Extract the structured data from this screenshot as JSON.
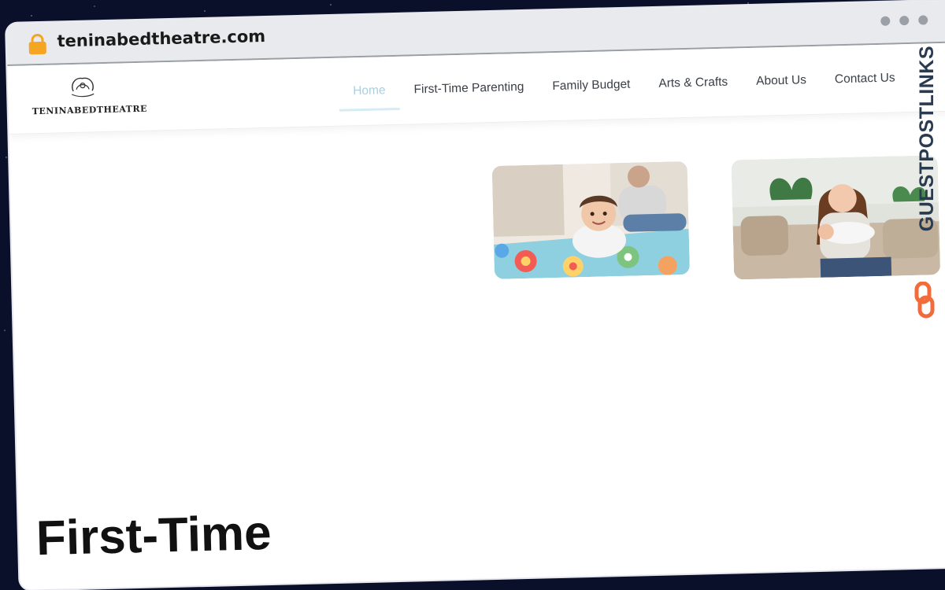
{
  "browser": {
    "url": "teninabedtheatre.com"
  },
  "site": {
    "logo_text": "TENINABEDTHEATRE",
    "nav": [
      {
        "label": "Home",
        "active": true
      },
      {
        "label": "First-Time Parenting",
        "active": false
      },
      {
        "label": "Family Budget",
        "active": false
      },
      {
        "label": "Arts & Crafts",
        "active": false
      },
      {
        "label": "About Us",
        "active": false
      },
      {
        "label": "Contact Us",
        "active": false
      }
    ],
    "hero_title": "First-Time"
  },
  "badge": {
    "text": "GUESTPOSTLINKS"
  },
  "colors": {
    "nav_active": "#a9cfe0",
    "lock": "#f5a524",
    "badge_text": "#2a3a4f",
    "badge_icon": "#f26b3a"
  }
}
